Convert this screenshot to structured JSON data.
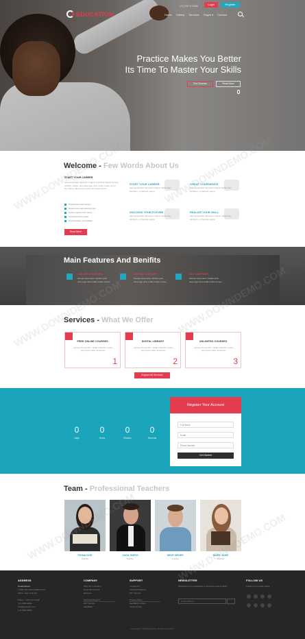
{
  "colors": {
    "accent_red": "#e23c4e",
    "accent_teal": "#1ba5bd",
    "footer_bg": "#262626"
  },
  "header": {
    "logo_text": "EDUCATION",
    "phone": "(+1) 8874 5386",
    "login_label": "Login",
    "register_label": "Register",
    "menu": [
      "Home",
      "Gallery",
      "Services",
      "Pages ▾",
      "Contact"
    ],
    "search_icon": "search-icon"
  },
  "hero": {
    "title_line1": "Practice Makes You Better",
    "title_line2": "Its Time To Master Your Skills",
    "button1": "Our Courses",
    "button2": "Read More"
  },
  "welcome": {
    "title": "Welcome - ",
    "title_muted": "Few Words About Us",
    "left_heading": "START YOUR CAREER",
    "left_text": "Sed perspiciatis dignissim magna. Curabitur blandit tempus porttitor. Nullam quis risus eget urna mollis ornare vel eu leo. Donec ullamcorper nulla non metus auctor.",
    "checklist": [
      "Professional web design",
      "Responsive web development",
      "Online support 24/7 hours",
      "Powerful admin panel",
      "Cross browser compatible"
    ],
    "button": "Read More",
    "features": [
      {
        "title": "START YOUR CAREER",
        "text": "Sed perspiciatis dignissim magna. Nulla vitae elit libero, a pharetra augue."
      },
      {
        "title": "GREAT CONFIDENCE",
        "text": "Sed perspiciatis dignissim magna. Nulla vitae elit libero, a pharetra augue."
      },
      {
        "title": "SUCCESS YOUR FUTURE",
        "text": "Sed perspiciatis dignissim magna. Nulla vitae elit libero, a pharetra augue."
      },
      {
        "title": "REALIZE YOUR SKILL",
        "text": "Sed perspiciatis dignissim magna. Nulla vitae elit libero, a pharetra augue."
      }
    ]
  },
  "main_features": {
    "title": "Main Features And Benifits",
    "items": [
      {
        "title": "ONLINE COURSES",
        "text": "Aenean fermentum. Nullam quis risus eget urna mollis ornare vel leo."
      },
      {
        "title": "DIGITAL LIBRARY",
        "text": "Aenean fermentum. Nullam quis risus eget urna mollis ornare vel leo."
      },
      {
        "title": "24/7 SUPPORT",
        "text": "Aenean fermentum. Nullam quis risus eget urna mollis ornare vel leo."
      }
    ]
  },
  "services": {
    "title": "Services - ",
    "title_muted": "What We Offer",
    "cards": [
      {
        "title": "FREE ONLINE COURSES",
        "text": "Aenean fermentum. Nullam blandit mi risus eget urna mollis ornare leo.",
        "number": "1"
      },
      {
        "title": "DIGITAL LIBRARY",
        "text": "Aenean fermentum. Nullam blandit mi risus eget urna mollis ornare leo.",
        "number": "2"
      },
      {
        "title": "UNLIMITED COURSES",
        "text": "Aenean fermentum. Nullam blandit mi risus eget urna mollis ornare leo.",
        "number": "3"
      }
    ],
    "button": "Explore All Services"
  },
  "counters": [
    {
      "value": "0",
      "label": "Days"
    },
    {
      "value": "0",
      "label": "Hours"
    },
    {
      "value": "0",
      "label": "Minutes"
    },
    {
      "value": "0",
      "label": "Seconds"
    }
  ],
  "register": {
    "title": "Register Your Account",
    "name_placeholder": "Full Name",
    "email_placeholder": "Email",
    "phone_placeholder": "Phone Number",
    "submit": "Get Started"
  },
  "team": {
    "title": "Team - ",
    "title_muted": "Professional Teachers",
    "members": [
      {
        "name": "FIONA DOE",
        "role": "Teacher"
      },
      {
        "name": "JACK SMITH",
        "role": "Teacher"
      },
      {
        "name": "MIKE HENRY",
        "role": "Teacher"
      },
      {
        "name": "MARY JANE",
        "role": "Teacher"
      }
    ]
  },
  "footer": {
    "address_title": "ADDRESS",
    "address_lines": [
      "Headquarters",
      "1 Main Str, Green Valley Drive",
      "Miami, New York City",
      "",
      "Phone - (111) 123 1234",
      "(+1) 0000 0000",
      "info@example.com",
      "(+1) 0000 0000"
    ],
    "company_title": "COMPANY",
    "company_links": [
      "Why Our Company",
      "Personal Account",
      "Services",
      "",
      "Technical Support",
      "24/7 Service",
      "Feedback"
    ],
    "support_title": "SUPPORT",
    "support_links": [
      "Contact Us",
      "Technical Support",
      "24/7 Service",
      "",
      "Privacy Policy",
      "Feedback & Help",
      "Terms of Use"
    ],
    "newsletter_title": "NEWSLETTER",
    "newsletter_text": "Subscribe to our newsletter to get latest news & deals.",
    "newsletter_placeholder": "Email address",
    "follow_title": "FOLLOW US",
    "follow_text": "Follow us on social media",
    "copyright": "Copyright © 2016 Education. All rights reserved."
  },
  "watermark": "WWW.DOWNDEMO.COM"
}
